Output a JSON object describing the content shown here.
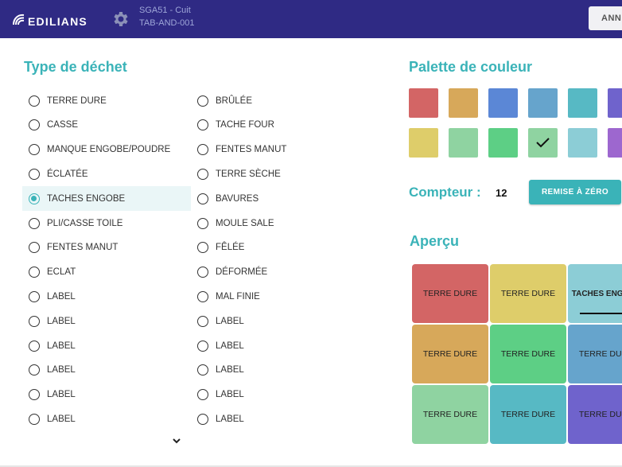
{
  "header": {
    "logo_text": "EDILIANS",
    "device_line1": "SGA51 - Cuit",
    "device_line2": "TAB-AND-001",
    "cancel_label": "ANNULER",
    "background": "#2f2a84"
  },
  "waste_type": {
    "title": "Type de déchet",
    "selected": "TACHES ENGOBE",
    "column1": [
      "TERRE DURE",
      "CASSE",
      "MANQUE ENGOBE/POUDRE",
      "ÉCLATÉE",
      "TACHES ENGOBE",
      "PLI/CASSE TOILE",
      "FENTES MANUT",
      "ECLAT",
      "LABEL",
      "LABEL",
      "LABEL",
      "LABEL",
      "LABEL",
      "LABEL"
    ],
    "column2": [
      "BRÛLÉE",
      "TACHE FOUR",
      "FENTES MANUT",
      "TERRE SÈCHE",
      "BAVURES",
      "MOULE SALE",
      "FÊLÉE",
      "DÉFORMÉE",
      "MAL FINIE",
      "LABEL",
      "LABEL",
      "LABEL",
      "LABEL",
      "LABEL"
    ],
    "more_icon": "chevron-down-icon"
  },
  "palette": {
    "title": "Palette de couleur",
    "row1": [
      "#d36565",
      "#d7a85a",
      "#5b87d6",
      "#66a4cc",
      "#57b9c4",
      "#6f63cc"
    ],
    "row2": [
      "#decd6a",
      "#8fd3a1",
      "#5dcf85",
      "#8fd3a1",
      "#8ccdd6",
      "#9d67cf"
    ],
    "selected_index_row2": 3,
    "check_icon": "check-icon"
  },
  "counter": {
    "label": "Compteur :",
    "value": "12",
    "reset_label": "REMISE À ZÉRO"
  },
  "preview": {
    "title": "Aperçu",
    "tiles": [
      {
        "label": "TERRE DURE",
        "color": "#d36565"
      },
      {
        "label": "TERRE DURE",
        "color": "#decd6a"
      },
      {
        "label": "TACHES ENGOBE",
        "color": "#8ccdd6",
        "bold": true
      },
      {
        "label": "TERRE DURE",
        "color": "#d7a85a"
      },
      {
        "label": "TERRE DURE",
        "color": "#5dcf85"
      },
      {
        "label": "TERRE DURE",
        "color": "#66a4cc"
      },
      {
        "label": "TERRE DURE",
        "color": "#8fd3a1"
      },
      {
        "label": "TERRE DURE",
        "color": "#57b9c4"
      },
      {
        "label": "TERRE DURE",
        "color": "#6f63cc"
      }
    ]
  }
}
